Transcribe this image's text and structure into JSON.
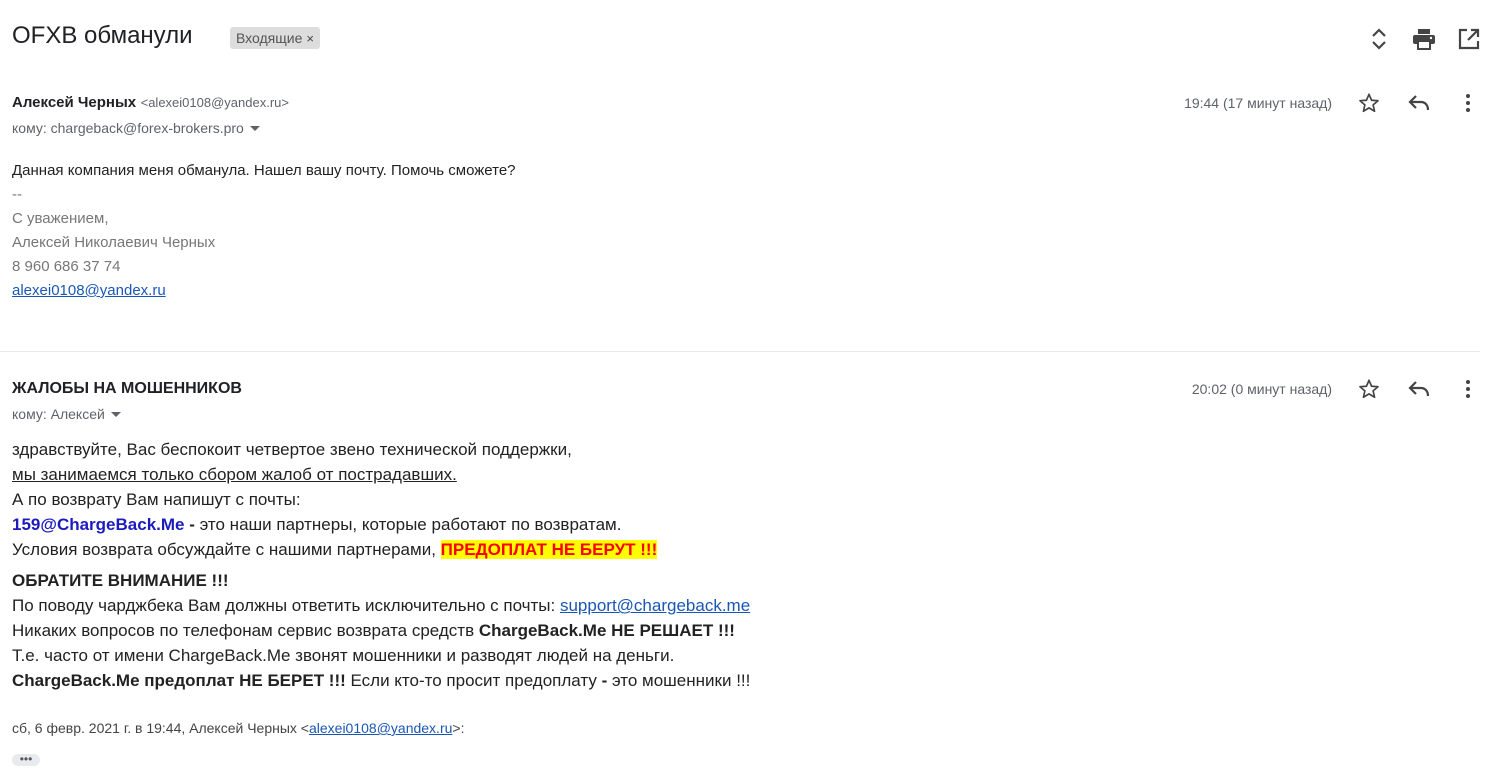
{
  "thread": {
    "subject": "OFXB обманули",
    "label": "Входящие",
    "label_remove": "×"
  },
  "message1": {
    "sender_name": "Алексей Черных",
    "sender_email": "<alexei0108@yandex.ru>",
    "to": "кому: chargeback@forex-brokers.pro",
    "time": "19:44 (17 минут назад)",
    "body": "Данная компания меня обманула. Нашел вашу почту. Помочь сможете?",
    "sig_sep": "--",
    "sig_greeting": "С уважением,",
    "sig_name": "Алексей Николаевич Черных",
    "sig_phone": "8 960 686 37 74",
    "sig_email": "alexei0108@yandex.ru"
  },
  "message2": {
    "sender_name": "ЖАЛОБЫ НА МОШЕННИКОВ",
    "to": "кому: Алексей",
    "time": "20:02 (0 минут назад)",
    "line1": "здравствуйте, Вас беспокоит четвертое звено технической поддержки,",
    "line2": "мы занимаемся только сбором жалоб от пострадавших.",
    "line3": "А по возврату Вам напишут с почты:",
    "line4_email": "159@ChargeBack.Me",
    "line4_dash": " - ",
    "line4_rest": "это наши партнеры, которые работают по возвратам.",
    "line5_text": "Условия возврата обсуждайте с нашими партнерами, ",
    "line5_highlight": "ПРЕДОПЛАТ НЕ БЕРУТ !!!",
    "line6": "ОБРАТИТЕ ВНИМАНИЕ !!!",
    "line7_text": "По поводу чарджбека Вам должны ответить исключительно с почты: ",
    "line7_link": "support@chargeback.me",
    "line8_text": "Никаких вопросов по телефонам сервис возврата средств ",
    "line8_bold": "ChargeBack.Me НЕ РЕШАЕТ !!!",
    "line9": "Т.е. часто от имени ChargeBack.Me звонят мошенники и разводят людей на деньги.",
    "line10_bold": "ChargeBack.Me предоплат НЕ БЕРЕТ !!!",
    "line10_text": " Если кто-то просит предоплату ",
    "line10_dash": "-",
    "line10_end": " это мошенники !!!",
    "quote_prefix": "сб, 6 февр. 2021 г. в 19:44, Алексей Черных <",
    "quote_email": "alexei0108@yandex.ru",
    "quote_suffix": ">:",
    "show_trimmed": "•••"
  },
  "icons": [
    "expand-collapse-icon",
    "print-icon",
    "open-in-new-window-icon",
    "star-icon",
    "reply-icon",
    "more-vert-icon"
  ],
  "colors": {
    "link": "#1a57b5",
    "partner_email": "#1c1bbd",
    "highlight_bg": "#ffff00",
    "highlight_text": "#ff0000",
    "label_chip": "#dddddd"
  }
}
